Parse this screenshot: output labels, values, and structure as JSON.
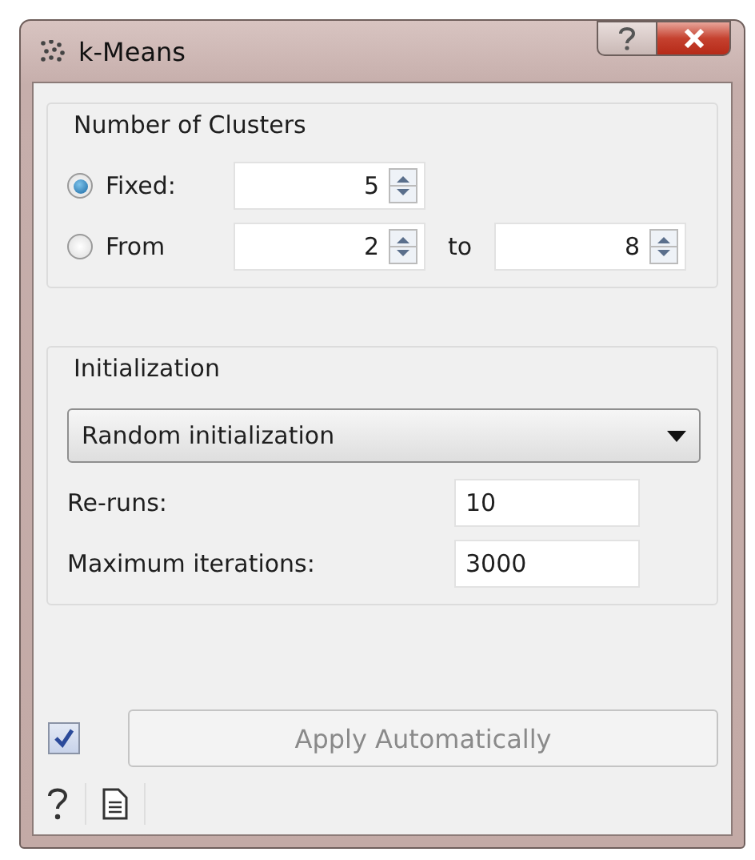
{
  "window": {
    "title": "k-Means"
  },
  "clusters": {
    "title": "Number of Clusters",
    "options": [
      {
        "label": "Fixed:",
        "selected": true,
        "value": "5"
      },
      {
        "label": "From",
        "selected": false,
        "value": "2",
        "separator": "to",
        "to": "8"
      }
    ]
  },
  "initialization": {
    "title": "Initialization",
    "method": "Random initialization",
    "fields": [
      {
        "label": "Re-runs:",
        "value": "10"
      },
      {
        "label": "Maximum iterations:",
        "value": "3000"
      }
    ]
  },
  "apply": {
    "auto": true,
    "label": "Apply Automatically",
    "disabled": true
  }
}
